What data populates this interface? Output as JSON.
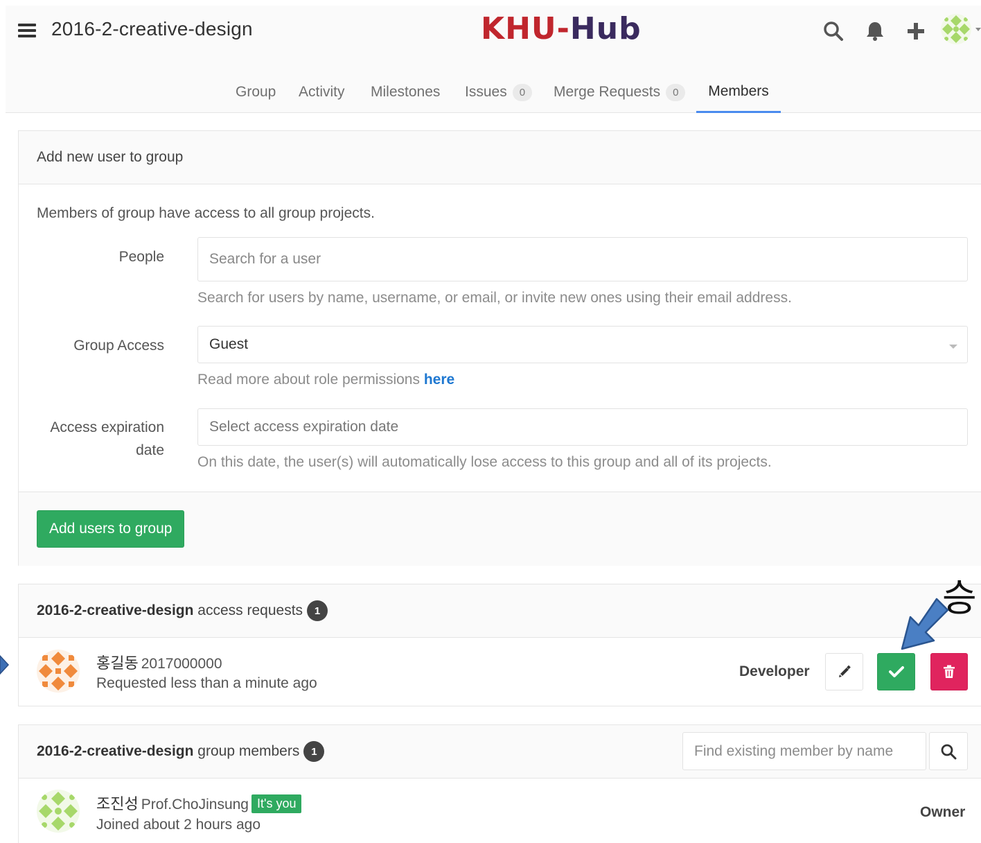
{
  "header": {
    "group_title": "2016-2-creative-design",
    "logo_left": "KHU-",
    "logo_right": "Hub",
    "icons": [
      "menu-icon",
      "search-icon",
      "bell-icon",
      "plus-icon",
      "avatar-pattern"
    ],
    "brand_colors": {
      "logo_red": "#c0262d",
      "logo_purple": "#3a2a5e",
      "accent_blue": "#4a8bee"
    }
  },
  "nav": {
    "group": "Group",
    "activity": "Activity",
    "milestones": "Milestones",
    "issues": "Issues",
    "issues_count": "0",
    "merge_requests": "Merge Requests",
    "merge_requests_count": "0",
    "members": "Members"
  },
  "add_form": {
    "heading": "Add new user to group",
    "intro": "Members of group have access to all group projects.",
    "people_label": "People",
    "people_placeholder": "Search for a user",
    "people_help": "Search for users by name, username, or email, or invite new ones using their email address.",
    "access_label": "Group Access",
    "access_value": "Guest",
    "access_help": "Read more about role permissions ",
    "access_help_link": "here",
    "expiry_label_1": "Access expiration",
    "expiry_label_2": "date",
    "expiry_placeholder": "Select access expiration date",
    "expiry_help": "On this date, the user(s) will automatically lose access to this group and all of its projects.",
    "submit": "Add users to group"
  },
  "access_requests": {
    "group_name": "2016-2-creative-design",
    "suffix": " access requests",
    "count": "1",
    "rows": [
      {
        "name": "홍길동",
        "username": "2017000000",
        "subtitle": "Requested less than a minute ago",
        "role": "Developer"
      }
    ]
  },
  "group_members": {
    "group_name": "2016-2-creative-design",
    "suffix": " group members",
    "count": "1",
    "search_placeholder": "Find existing member by name",
    "rows": [
      {
        "name": "조진성",
        "username": "Prof.ChoJinsung",
        "badge": "It's you",
        "subtitle": "Joined about 2 hours ago",
        "role": "Owner"
      }
    ]
  },
  "annotation": {
    "label": "승"
  },
  "colors": {
    "approve": "#2faa60",
    "delete": "#e0245e",
    "link": "#1f78d1"
  }
}
